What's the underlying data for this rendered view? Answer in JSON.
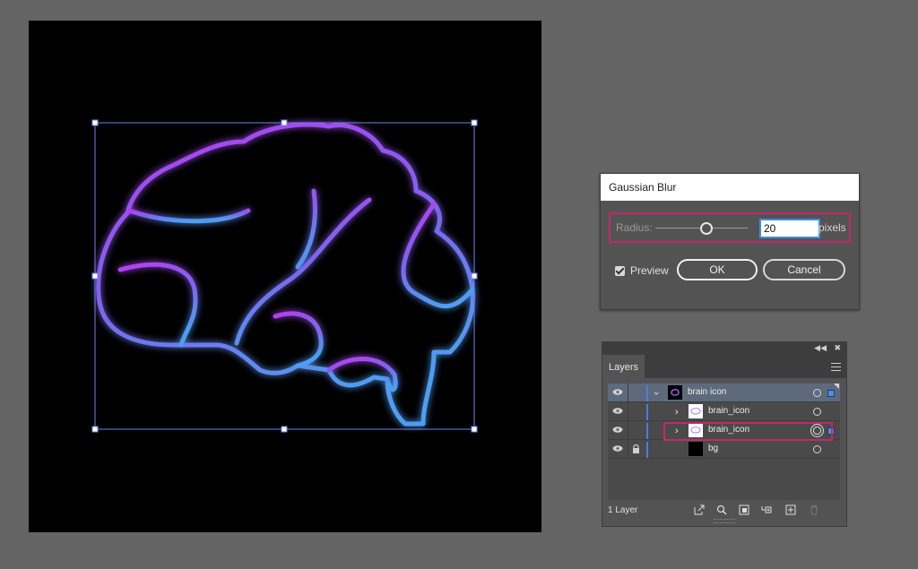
{
  "dialog": {
    "title": "Gaussian Blur",
    "radius_label": "Radius:",
    "radius_value": "20",
    "radius_unit": "pixels",
    "radius_slider_fraction": 0.55,
    "preview_label": "Preview",
    "preview_checked": true,
    "ok_label": "OK",
    "cancel_label": "Cancel"
  },
  "layers_panel": {
    "tab_label": "Layers",
    "layer_count": "1 Layer",
    "rows": [
      {
        "name": "brain icon",
        "visible": true,
        "locked": false,
        "expanded": true,
        "selected": true
      },
      {
        "name": "brain_icon",
        "visible": true,
        "locked": false,
        "expanded": false,
        "selected": false
      },
      {
        "name": "brain_icon",
        "visible": true,
        "locked": false,
        "expanded": false,
        "selected": false,
        "targeted": true
      },
      {
        "name": "bg",
        "visible": true,
        "locked": true,
        "expanded": false,
        "selected": false
      }
    ]
  },
  "colors": {
    "canvas_bg": "#646464",
    "artboard_bg": "#000000",
    "glow_top": "#b33ff0",
    "glow_bottom": "#4f9df0",
    "highlight": "#c2286b",
    "selection_blue": "#4f7be0"
  }
}
